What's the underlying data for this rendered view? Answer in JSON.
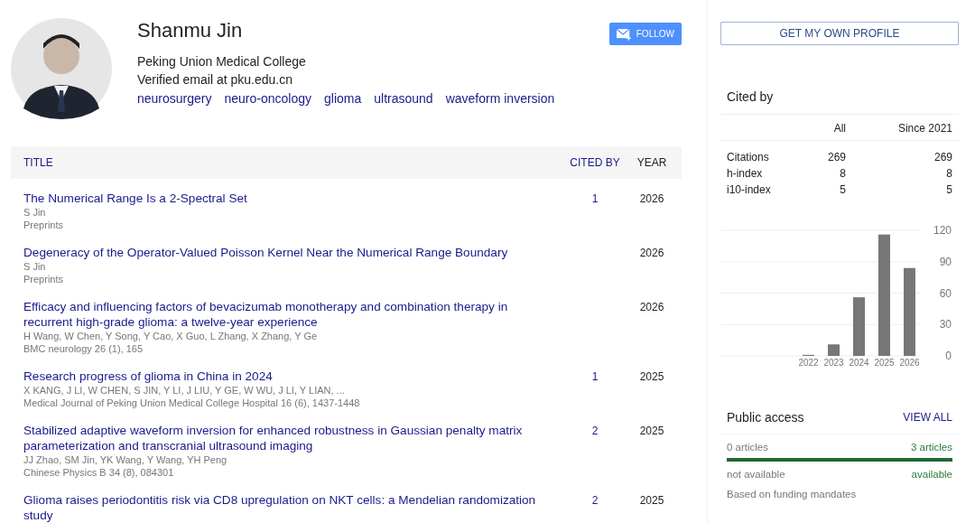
{
  "profile": {
    "name": "Shanmu Jin",
    "affiliation": "Peking Union Medical College",
    "email": "Verified email at pku.edu.cn",
    "interests": [
      "neurosurgery",
      "neuro-oncology",
      "glioma",
      "ultrasound",
      "waveform inversion"
    ],
    "follow_button": "FOLLOW"
  },
  "table": {
    "columns": [
      "TITLE",
      "CITED BY",
      "YEAR"
    ],
    "rows": [
      {
        "title": "The Numerical Range Is a 2-Spectral Set",
        "authors": "S Jin",
        "venue": "Preprints",
        "cited_by": "1",
        "year": "2026"
      },
      {
        "title": "Degeneracy of the Operator-Valued Poisson Kernel Near the Numerical Range Boundary",
        "authors": "S Jin",
        "venue": "Preprints",
        "year": "2026"
      },
      {
        "title": "Efficacy and influencing factors of bevacizumab monotherapy and combination therapy in recurrent high-grade glioma: a twelve-year experience",
        "authors": "H Wang, W Chen, Y Song, Y Cao, X Guo, L Zhang, X Zhang, Y Ge",
        "venue": "BMC neurology 26 (1), 165",
        "year": "2026"
      },
      {
        "title": "Research progress of glioma in China in 2024",
        "authors": "X KANG, J LI, W CHEN, S JIN, Y LI, J LIU, Y GE, W WU, J LI, Y LIAN, ...",
        "venue": "Medical Journal of Peking Union Medical College Hospital 16 (6), 1437-1448",
        "cited_by": "1",
        "year": "2025"
      },
      {
        "title": "Stabilized adaptive waveform inversion for enhanced robustness in Gaussian penalty matrix parameterization and transcranial ultrasound imaging",
        "authors": "JJ Zhao, SM Jin, YK Wang, Y Wang, YH Peng",
        "venue": "Chinese Physics B 34 (8), 084301",
        "cited_by": "2",
        "year": "2025"
      },
      {
        "title": "Glioma raises periodontitis risk via CD8 upregulation on NKT cells: a Mendelian randomization study",
        "cited_by": "2",
        "year": "2025"
      }
    ]
  },
  "sidebar": {
    "profile_button": "GET MY OWN PROFILE",
    "cited_by": {
      "title": "Cited by",
      "columns": [
        "All",
        "Since 2021"
      ],
      "rows": [
        {
          "label": "Citations",
          "all": "269",
          "since": "269"
        },
        {
          "label": "h-index",
          "all": "8",
          "since": "8"
        },
        {
          "label": "i10-index",
          "all": "5",
          "since": "5"
        }
      ],
      "chart_data": {
        "type": "bar",
        "categories": [
          "2022",
          "2023",
          "2024",
          "2025",
          "2026"
        ],
        "values": [
          1,
          11,
          56,
          116,
          84
        ],
        "ylim": [
          0,
          120
        ],
        "grid": true,
        "yticks": [
          0,
          30,
          60,
          90,
          120
        ]
      }
    },
    "public_access": {
      "title": "Public access",
      "view_all": "VIEW ALL",
      "not_available_count": "0 articles",
      "available_count": "3 articles",
      "level": 1,
      "not_available_label": "not available",
      "available_label": "available",
      "note": "Based on funding mandates"
    }
  }
}
